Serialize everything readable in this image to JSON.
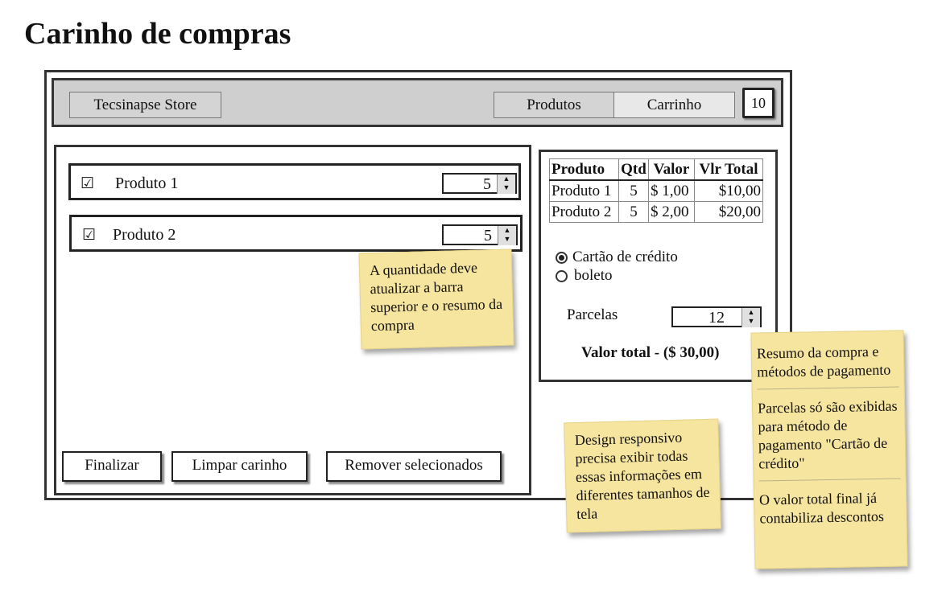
{
  "page": {
    "title": "Carinho de compras"
  },
  "topbar": {
    "store": "Tecsinapse Store",
    "tab_products": "Produtos",
    "tab_cart": "Carrinho",
    "badge": "10"
  },
  "items": [
    {
      "checkbox": "☑",
      "label": "Produto 1",
      "qty": "5"
    },
    {
      "checkbox": "☑",
      "label": "Produto 2",
      "qty": "5"
    }
  ],
  "buttons": {
    "finalize": "Finalizar",
    "clear": "Limpar carinho",
    "remove": "Remover selecionados"
  },
  "summary": {
    "headers": [
      "Produto",
      "Qtd",
      "Valor",
      "Vlr Total"
    ],
    "rows": [
      [
        "Produto 1",
        "5",
        "$ 1,00",
        "$10,00"
      ],
      [
        "Produto 2",
        "5",
        "$ 2,00",
        "$20,00"
      ]
    ]
  },
  "payment": {
    "options": [
      "Cartão de crédito",
      "boleto"
    ],
    "selected": "Cartão de crédito",
    "installments_label": "Parcelas",
    "installments_value": "12",
    "total_label": "Valor total -",
    "total_value": "($ 30,00)"
  },
  "notes": {
    "qty": "A quantidade deve atualizar a barra superior e o resumo da compra",
    "responsive": "Design responsivo precisa exibir todas essas informações em diferentes tamanhos de tela",
    "summary_sections": [
      "Resumo da compra e métodos de pagamento",
      "Parcelas só são exibidas para método de pagamento \"Cartão de crédito\"",
      "O valor total final já contabiliza descontos"
    ]
  }
}
